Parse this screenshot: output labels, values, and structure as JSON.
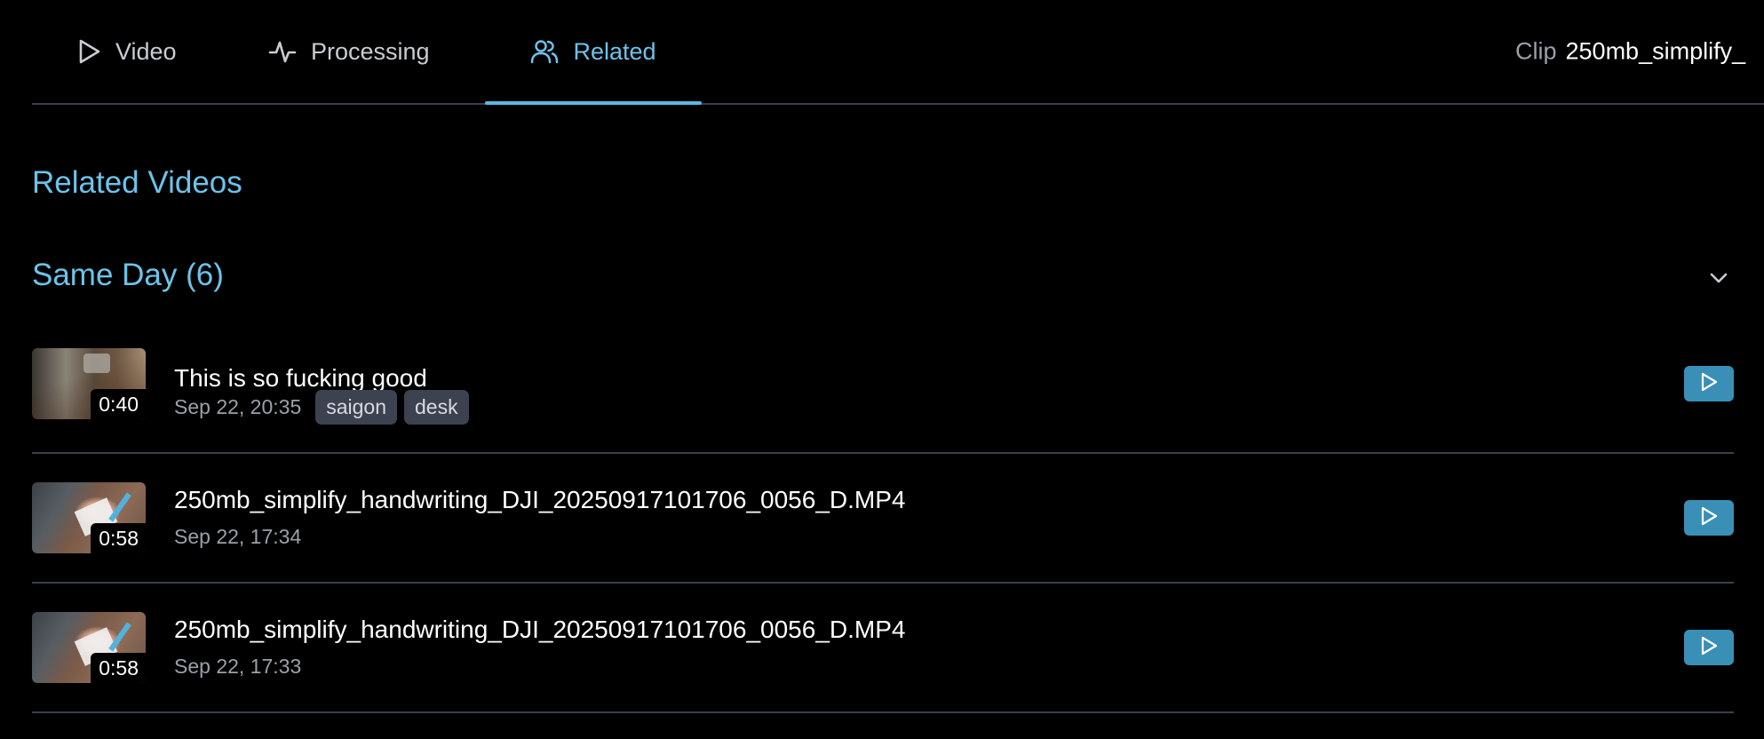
{
  "tabs": {
    "video": "Video",
    "processing": "Processing",
    "related": "Related"
  },
  "clip": {
    "label": "Clip",
    "value": "250mb_simplify_"
  },
  "section_title": "Related Videos",
  "group": {
    "title": "Same Day (6)"
  },
  "videos": [
    {
      "title": "This is so fucking good",
      "date": "Sep 22, 20:35",
      "duration": "0:40",
      "tags": [
        "saigon",
        "desk"
      ]
    },
    {
      "title": "250mb_simplify_handwriting_DJI_20250917101706_0056_D.MP4",
      "date": "Sep 22, 17:34",
      "duration": "0:58",
      "tags": []
    },
    {
      "title": "250mb_simplify_handwriting_DJI_20250917101706_0056_D.MP4",
      "date": "Sep 22, 17:33",
      "duration": "0:58",
      "tags": []
    }
  ],
  "colors": {
    "accent": "#6cc3ea",
    "play_button": "#3a8fb7",
    "tag_bg": "#3c4250",
    "divider": "#3a3f4a"
  },
  "icons": {
    "video_tab": "play-icon",
    "processing_tab": "activity-icon",
    "related_tab": "users-icon",
    "collapse": "chevron-down-icon",
    "row_action": "play-icon"
  }
}
